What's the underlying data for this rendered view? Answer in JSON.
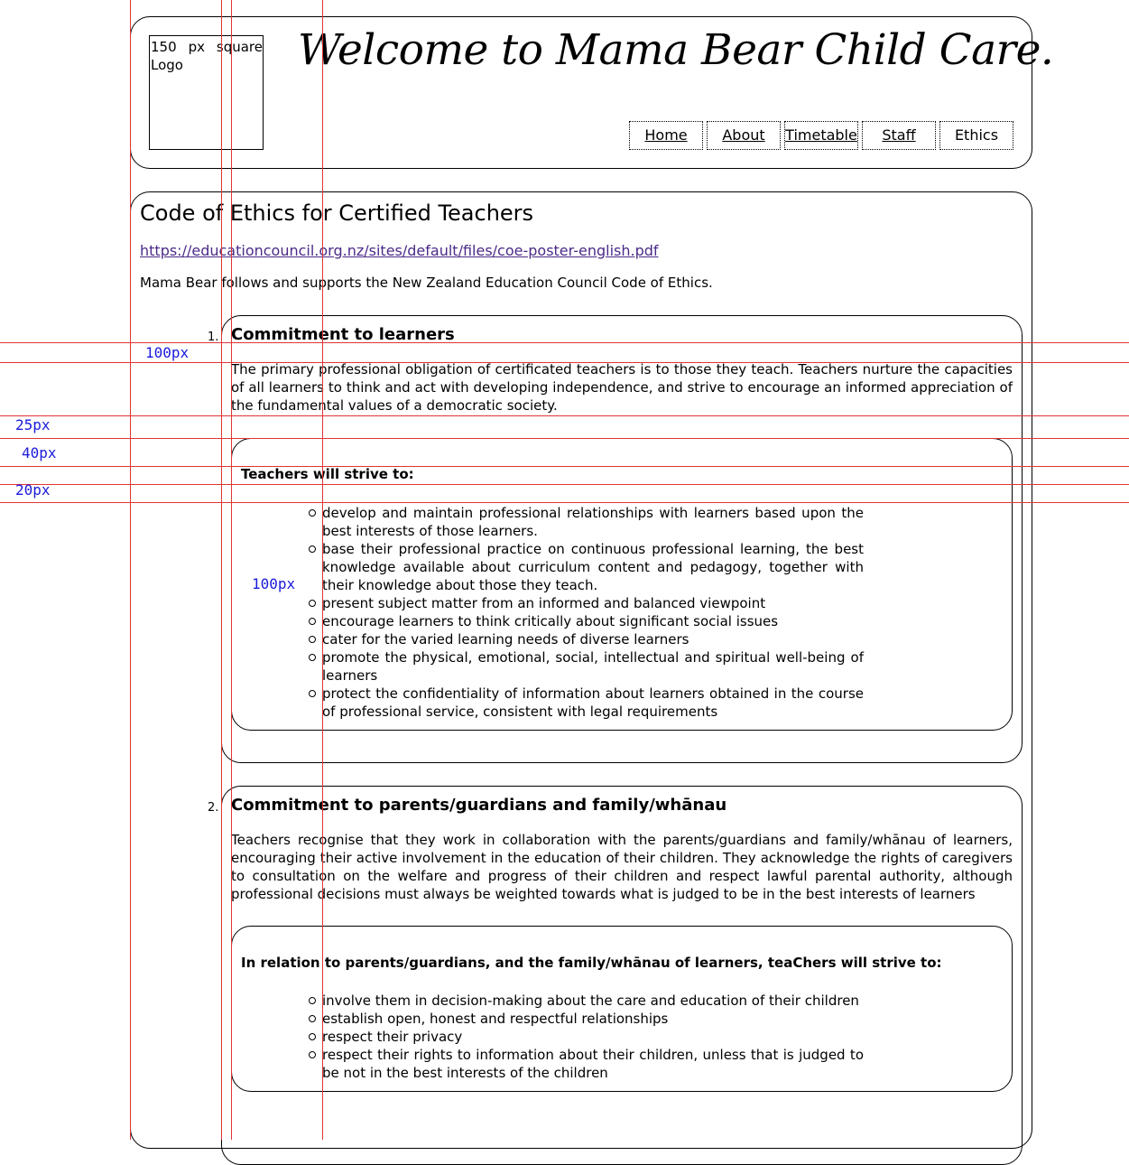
{
  "header": {
    "logo_text": "150 px square Logo",
    "site_title": "Welcome to Mama Bear Child Care.",
    "nav": [
      "Home",
      "About",
      "Timetable",
      "Staff",
      "Ethics"
    ]
  },
  "main": {
    "heading": "Code of Ethics for Certified Teachers",
    "link_url": "https://educationcouncil.org.nz/sites/default/files/coe-poster-english.pdf",
    "intro": "Mama Bear follows and supports the New Zealand Education Council Code of Ethics.",
    "sections": [
      {
        "number": "1.",
        "title": "Commitment to learners",
        "paragraph": "The primary professional obligation of certificated teachers is to those they teach. Teachers nurture the capacities of all learners to think and act with developing independence, and strive to encourage an informed appreciation of the fundamental values of a democratic society.",
        "strive_heading": "Teachers will strive to:",
        "items": [
          "develop and maintain professional relationships with learners based upon the best interests of those learners.",
          "base their professional practice on continuous professional learning, the best knowledge available about curriculum content and pedagogy, together with their knowledge about those they teach.",
          "present subject matter from an informed and balanced viewpoint",
          "encourage learners to think critically about significant social issues",
          "cater for the varied learning needs of diverse learners",
          "promote the physical, emotional, social, intellectual and spiritual well-being of learners",
          "protect the confidentiality of information about learners obtained in the course of professional service, consistent with legal requirements"
        ]
      },
      {
        "number": "2.",
        "title": "Commitment to parents/guardians and family/whānau",
        "paragraph": "Teachers recognise that they work in collaboration with the parents/guardians and family/whānau of learners, encouraging their active involvement in the education of their children. They acknowledge the rights of caregivers to consultation on the welfare and progress of their children and respect lawful parental authority, although professional decisions must always be weighted towards what is judged to be in the best interests of learners",
        "strive_heading": "In relation to parents/guardians, and the family/whānau of learners, teaChers will strive to:",
        "items": [
          "involve them in decision-making about the care and education of their children",
          "establish open, honest and respectful relationships",
          "respect their privacy",
          "respect their rights to information about their children, unless that is judged to be not in the best interests of the children"
        ]
      }
    ]
  },
  "guides": {
    "labels": [
      "100px",
      "25px",
      "40px",
      "20px",
      "100px"
    ],
    "color": "#e03535",
    "label_color": "#1a1adc"
  }
}
